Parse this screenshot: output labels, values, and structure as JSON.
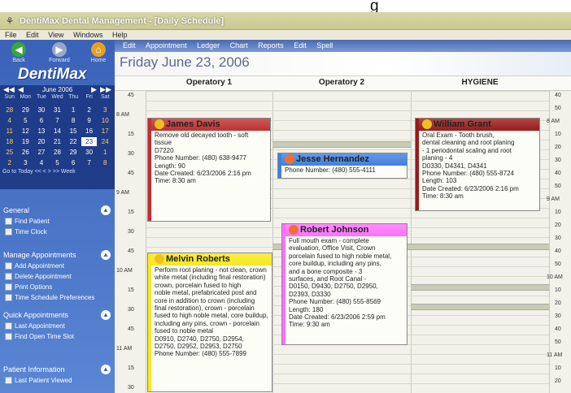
{
  "partial_title": "g",
  "window": {
    "title": "DentiMax Dental Management - [Daily Schedule]",
    "logo_icon": "tooth-icon"
  },
  "menu": [
    "File",
    "Edit",
    "View",
    "Windows",
    "Help"
  ],
  "sidebar": {
    "buttons": [
      {
        "label": "Back",
        "icon": "back-arrow-icon"
      },
      {
        "label": "Forward",
        "icon": "forward-arrow-icon"
      },
      {
        "label": "Home",
        "icon": "home-icon"
      }
    ],
    "brand": "DentiMax",
    "calendar": {
      "month_label": "June 2006",
      "dow": [
        "Sun",
        "Mon",
        "Tue",
        "Wed",
        "Thu",
        "Fri",
        "Sat"
      ],
      "weeks": [
        [
          "28",
          "29",
          "30",
          "31",
          "1",
          "2",
          "3"
        ],
        [
          "4",
          "5",
          "6",
          "7",
          "8",
          "9",
          "10"
        ],
        [
          "11",
          "12",
          "13",
          "14",
          "15",
          "16",
          "17"
        ],
        [
          "18",
          "19",
          "20",
          "21",
          "22",
          "23",
          "24"
        ],
        [
          "25",
          "26",
          "27",
          "28",
          "29",
          "30",
          "1"
        ],
        [
          "2",
          "3",
          "4",
          "5",
          "6",
          "7",
          "8"
        ]
      ],
      "selected": "23",
      "footer": "Go to Today  <<  <  >  >>  Week"
    },
    "panels": [
      {
        "title": "General",
        "items": [
          {
            "label": "Find Patient"
          },
          {
            "label": "Time Clock"
          }
        ]
      },
      {
        "title": "Manage Appointments",
        "items": [
          {
            "label": "Add Appointment"
          },
          {
            "label": "Delete Appointment"
          },
          {
            "label": "Print Options"
          },
          {
            "label": "Time Schedule Preferences"
          }
        ]
      },
      {
        "title": "Quick Appointments",
        "items": [
          {
            "label": "Last Appointment"
          },
          {
            "label": "Find Open Time Slot"
          }
        ]
      },
      {
        "title": "Patient Information",
        "items": [
          {
            "label": "Last Patient Viewed"
          }
        ]
      }
    ]
  },
  "main": {
    "toolbar": [
      "Edit",
      "Appointment",
      "Ledger",
      "Chart",
      "Reports",
      "Edit",
      "Spell"
    ],
    "date_title": "Friday June 23, 2006",
    "columns": [
      "Operatory 1",
      "Operatory 2",
      "HYGIENE"
    ],
    "time_labels_left": [
      "45",
      "8 AM",
      "15",
      "30",
      "45",
      "9 AM",
      "15",
      "30",
      "45",
      "10 AM",
      "15",
      "30",
      "45",
      "11 AM",
      "15",
      "30"
    ],
    "time_labels_right": [
      "40",
      "50",
      "8 AM",
      "10",
      "20",
      "30",
      "40",
      "50",
      "9 AM",
      "10",
      "20",
      "30",
      "40",
      "50",
      "10 AM",
      "10",
      "20",
      "30",
      "40",
      "50",
      "11 AM",
      "10",
      "20"
    ]
  },
  "appointments": [
    {
      "name": "James Davis",
      "color": "#c03030",
      "smile": "#f0c020",
      "lines": [
        "Remove old decayed tooth - soft",
        "tissue",
        "D7220",
        "Phone Number: (480) 638-9477",
        "Length: 90",
        "Date Created: 6/23/2006 2:16 pm",
        "Time: 8:30 am"
      ]
    },
    {
      "name": "Jesse Hernandez",
      "color": "#4080e0",
      "smile": "#f07030",
      "lines": [
        "Phone Number: (480) 555-4111"
      ]
    },
    {
      "name": "William Grant",
      "color": "#9a1a1a",
      "smile": "#f0c020",
      "lines": [
        "Oral Exam - Tooth brush,",
        "dental cleaning and root planing",
        "- 1 periodontal scaling and root",
        "planing - 4",
        "D0330, D4341, D4341",
        "Phone Number: (480) 555-8724",
        "Length: 103",
        "Date Created: 6/23/2006 2:16 pm",
        "Time: 8:30 am"
      ]
    },
    {
      "name": "Robert Johnson",
      "color": "#ff70ff",
      "smile": "#f07030",
      "lines": [
        "Full mouth exam - complete",
        "evaluation, Office Visit, Crown",
        "porcelain fused to high noble metal,",
        "core buildup, including any pins,",
        "and a bone composite - 3",
        "surfaces, and Root Canal -",
        "D0150, D9430, D2750, D2950,",
        "D2393, D3330",
        "Phone Number: (480) 555-8569",
        "Length: 180",
        "Date Created: 6/23/2006 2:59 pm",
        "Time: 9:30 am"
      ]
    },
    {
      "name": "Melvin Roberts",
      "color": "#f8e820",
      "smile": "#f0c020",
      "lines": [
        "Perform root planing - not clean, crown",
        "white metal (including final restoration)",
        "crown, porcelain fused to high",
        "noble metal, prefabricated post and",
        "core in addition to crown (including",
        "final restoration), crown - porcelain",
        "fused to high noble metal, core buildup,",
        "including any pins, crown - porcelain",
        "fused to noble metal",
        "D0910, D2740, D2750, D2954,",
        "D2750, D2952, D2953, D2750",
        "Phone Number: (480) 555-7899"
      ]
    }
  ]
}
